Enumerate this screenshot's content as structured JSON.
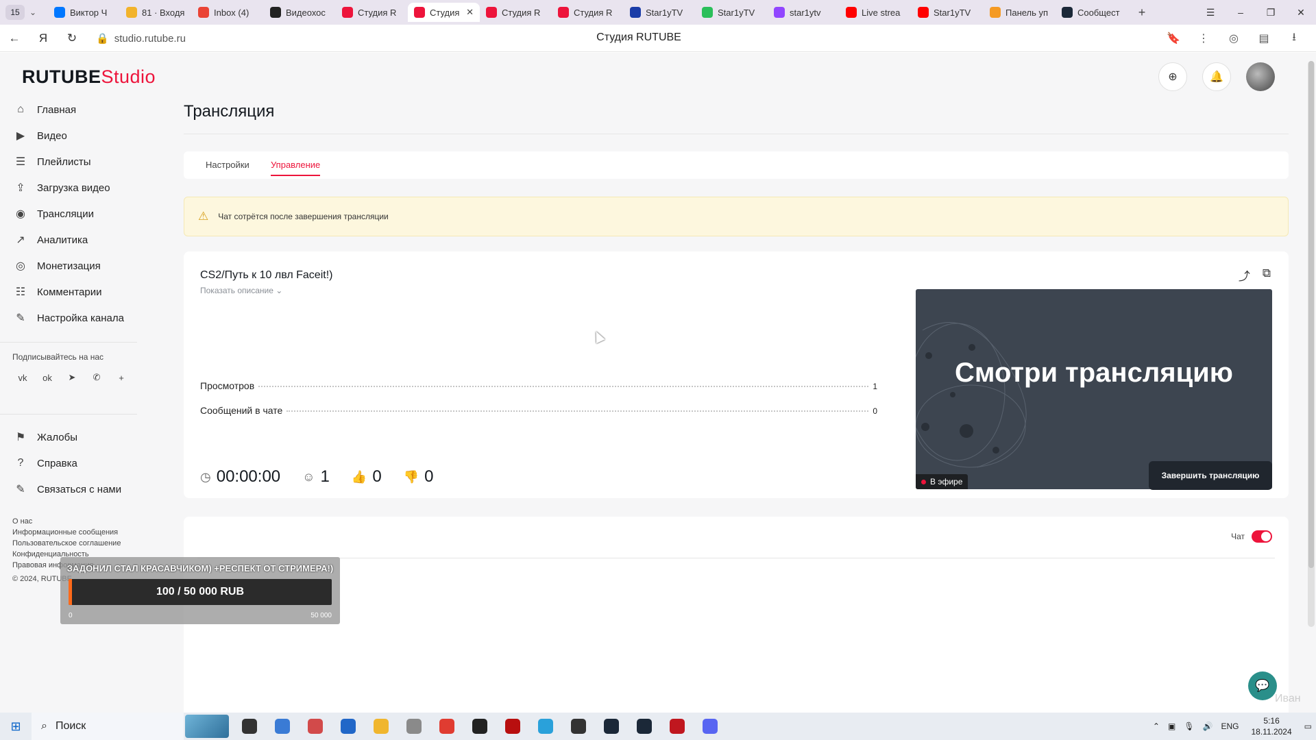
{
  "browser": {
    "tab_count": "15",
    "tabs": [
      {
        "title": "Виктор Ч",
        "color": "#0077ff"
      },
      {
        "title": "81 · Входя",
        "color": "#f2b32b"
      },
      {
        "title": "Inbox (4)",
        "color": "#ea4335"
      },
      {
        "title": "Видеохос",
        "color": "#222222"
      },
      {
        "title": "Студия R",
        "color": "#ed143b"
      },
      {
        "title": "Студия",
        "color": "#ed143b",
        "active": true
      },
      {
        "title": "Студия R",
        "color": "#ed143b"
      },
      {
        "title": "Студия R",
        "color": "#ed143b"
      },
      {
        "title": "Star1yTV",
        "color": "#1a3ca8"
      },
      {
        "title": "Star1yTV",
        "color": "#2bbf5a"
      },
      {
        "title": "star1ytv",
        "color": "#9146ff"
      },
      {
        "title": "Live strea",
        "color": "#ff0000"
      },
      {
        "title": "Star1yTV",
        "color": "#ff0000"
      },
      {
        "title": "Панель уп",
        "color": "#f59a23"
      },
      {
        "title": "Сообщест",
        "color": "#1b2838"
      }
    ],
    "url": "studio.rutube.ru",
    "page_title": "Студия RUTUBE"
  },
  "logo": {
    "part1": "RUTUBE",
    "part2": "Studio"
  },
  "sidebar": {
    "items": [
      {
        "label": "Главная",
        "icon": "home-icon",
        "glyph": "⌂"
      },
      {
        "label": "Видео",
        "icon": "video-icon",
        "glyph": "▶"
      },
      {
        "label": "Плейлисты",
        "icon": "playlist-icon",
        "glyph": "☰"
      },
      {
        "label": "Загрузка видео",
        "icon": "upload-icon",
        "glyph": "⇪"
      },
      {
        "label": "Трансляции",
        "icon": "broadcast-icon",
        "glyph": "◉"
      },
      {
        "label": "Аналитика",
        "icon": "analytics-icon",
        "glyph": "↗"
      },
      {
        "label": "Монетизация",
        "icon": "monetization-icon",
        "glyph": "◎"
      },
      {
        "label": "Комментарии",
        "icon": "comments-icon",
        "glyph": "☷"
      },
      {
        "label": "Настройка канала",
        "icon": "channel-settings-icon",
        "glyph": "✎"
      }
    ],
    "subscribe_title": "Подписывайтесь на нас",
    "help_items": [
      {
        "label": "Жалобы",
        "icon": "flag-icon",
        "glyph": "⚑"
      },
      {
        "label": "Справка",
        "icon": "help-icon",
        "glyph": "?"
      },
      {
        "label": "Связаться с нами",
        "icon": "contact-icon",
        "glyph": "✎"
      }
    ],
    "footer_links": [
      "О нас",
      "Информационные сообщения",
      "Пользовательское соглашение",
      "Конфиденциальность",
      "Правовая информация"
    ],
    "copyright": "© 2024, RUTUBE"
  },
  "main": {
    "title": "Трансляция",
    "tabs": [
      "Настройки",
      "Управление"
    ],
    "warning": "Чат сотрётся после завершения трансляции",
    "stream": {
      "title": "CS2/Путь к 10 лвл Faceit!)",
      "show_description": "Показать описание",
      "stats": [
        {
          "label": "Просмотров",
          "value": "1"
        },
        {
          "label": "Сообщений в чате",
          "value": "0"
        }
      ],
      "preview_text": "Смотри трансляцию",
      "live_label": "В эфире",
      "duration": "00:00:00",
      "viewers": "1",
      "likes": "0",
      "dislikes": "0",
      "end_button": "Завершить трансляцию"
    },
    "chat_label": "Чат"
  },
  "donation_overlay": {
    "text": "ЗАДОНИЛ СТАЛ КРАСАВЧИКОМ) +РЕСПЕКТ ОТ СТРИМЕРА!)",
    "amount": "100 / 50 000 RUB",
    "progress": 0.002,
    "min": "0",
    "max": "50 000"
  },
  "watermark": "Иван",
  "taskbar": {
    "search": "Поиск",
    "apps": [
      {
        "name": "task-view-icon",
        "color": "#333333"
      },
      {
        "name": "app-1-icon",
        "color": "#3a7bd5"
      },
      {
        "name": "app-2-icon",
        "color": "#d24a4a"
      },
      {
        "name": "store-icon",
        "color": "#2167c8"
      },
      {
        "name": "explorer-icon",
        "color": "#f0b62e"
      },
      {
        "name": "app-3-icon",
        "color": "#8a8a8a"
      },
      {
        "name": "yandex-browser-icon",
        "color": "#e03c31"
      },
      {
        "name": "app-4-icon",
        "color": "#222222"
      },
      {
        "name": "app-5-icon",
        "color": "#b80f0f"
      },
      {
        "name": "telegram-icon",
        "color": "#2aa1da"
      },
      {
        "name": "app-6-icon",
        "color": "#333333"
      },
      {
        "name": "steam-icon",
        "color": "#1b2838"
      },
      {
        "name": "steam-2-icon",
        "color": "#1b2838"
      },
      {
        "name": "app-7-icon",
        "color": "#c0171f"
      },
      {
        "name": "discord-icon",
        "color": "#5865f2"
      }
    ],
    "lang": "ENG",
    "time": "5:16",
    "date": "18.11.2024"
  },
  "colors": {
    "accent": "#ed143b",
    "dark_button": "#20262e",
    "warning_bg": "#fdf7de"
  }
}
